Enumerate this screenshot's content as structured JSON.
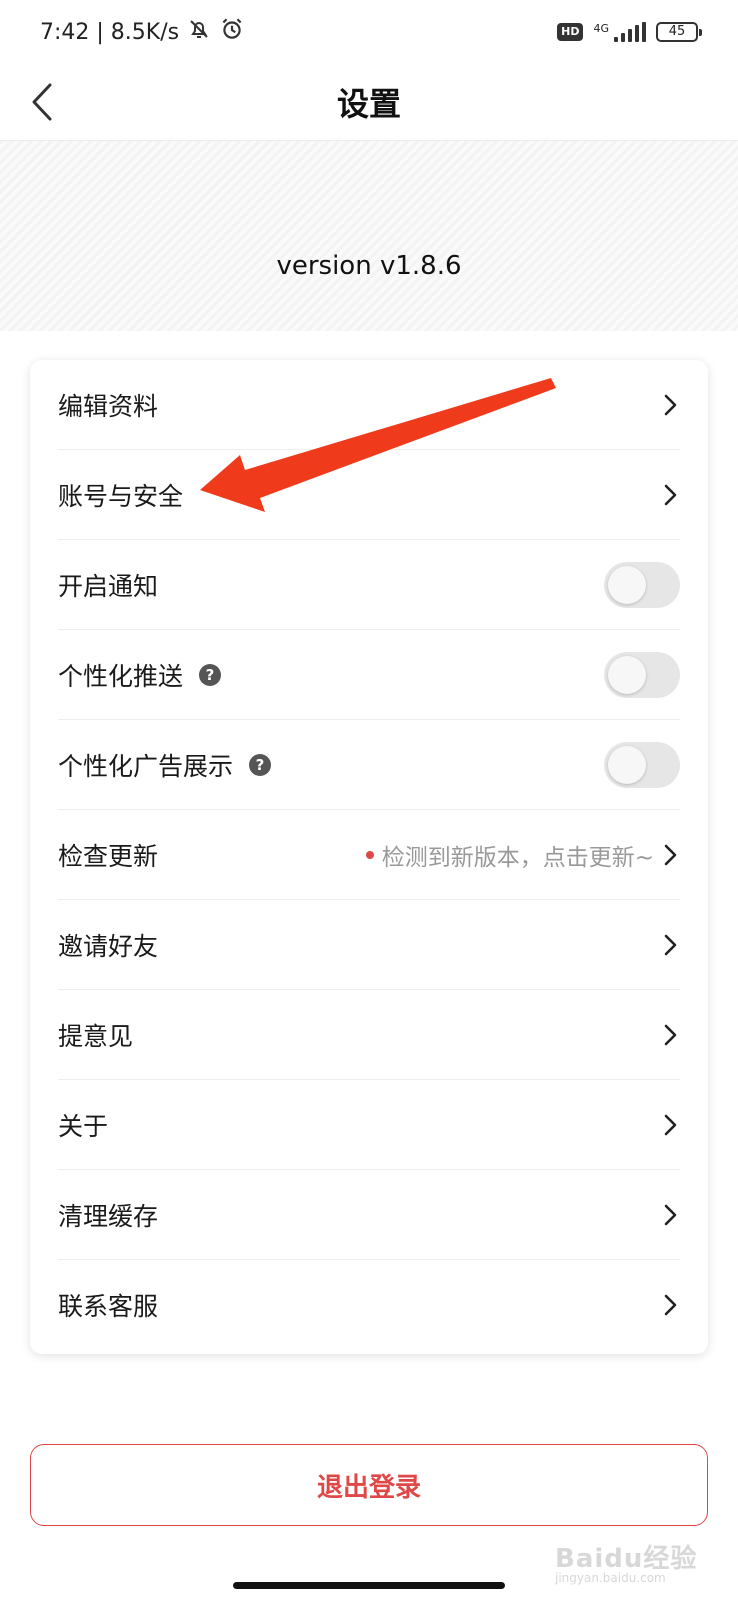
{
  "status_bar": {
    "time_speed": "7:42 | 8.5K/s",
    "hd": "HD",
    "network": "4G",
    "battery": "45"
  },
  "header": {
    "title": "设置"
  },
  "banner": {
    "version": "version v1.8.6"
  },
  "settings": {
    "items": [
      {
        "label": "编辑资料"
      },
      {
        "label": "账号与安全"
      },
      {
        "label": "开启通知"
      },
      {
        "label": "个性化推送"
      },
      {
        "label": "个性化广告展示"
      },
      {
        "label": "检查更新",
        "hint": "检测到新版本，点击更新~"
      },
      {
        "label": "邀请好友"
      },
      {
        "label": "提意见"
      },
      {
        "label": "关于"
      },
      {
        "label": "清理缓存"
      },
      {
        "label": "联系客服"
      }
    ],
    "help_mark": "?"
  },
  "logout": {
    "label": "退出登录"
  },
  "watermark": {
    "text": "Baidu经验",
    "sub": "jingyan.baidu.com"
  },
  "colors": {
    "accent_red": "#e04848",
    "annotation_arrow": "#f03a1c",
    "toggle_off": "#e6e6e6"
  }
}
